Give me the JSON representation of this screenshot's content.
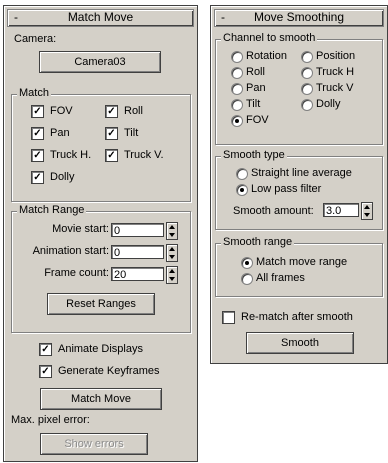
{
  "match_move": {
    "title": "Match Move",
    "collapse_symbol": "-",
    "camera_label": "Camera:",
    "camera_button": "Camera03",
    "match_group": {
      "title": "Match",
      "checkboxes": [
        {
          "label": "FOV",
          "checked": true
        },
        {
          "label": "Roll",
          "checked": true
        },
        {
          "label": "Pan",
          "checked": true
        },
        {
          "label": "Tilt",
          "checked": true
        },
        {
          "label": "Truck H.",
          "checked": true
        },
        {
          "label": "Truck V.",
          "checked": true
        },
        {
          "label": "Dolly",
          "checked": true
        }
      ]
    },
    "range_group": {
      "title": "Match Range",
      "movie_start_label": "Movie start:",
      "movie_start_value": "0",
      "animation_start_label": "Animation start:",
      "animation_start_value": "0",
      "frame_count_label": "Frame count:",
      "frame_count_value": "20",
      "reset_button": "Reset Ranges"
    },
    "animate_displays": {
      "label": "Animate Displays",
      "checked": true
    },
    "generate_keyframes": {
      "label": "Generate Keyframes",
      "checked": true
    },
    "match_move_button": "Match Move",
    "max_pixel_error_label": "Max. pixel error:",
    "show_errors_button": "Show errors",
    "check_glyph": "✓"
  },
  "move_smoothing": {
    "title": "Move Smoothing",
    "collapse_symbol": "-",
    "channel_group": {
      "title": "Channel to smooth",
      "options": [
        {
          "label": "Rotation",
          "selected": false
        },
        {
          "label": "Position",
          "selected": false
        },
        {
          "label": "Roll",
          "selected": false
        },
        {
          "label": "Truck H",
          "selected": false
        },
        {
          "label": "Pan",
          "selected": false
        },
        {
          "label": "Truck V",
          "selected": false
        },
        {
          "label": "Tilt",
          "selected": false
        },
        {
          "label": "Dolly",
          "selected": false
        },
        {
          "label": "FOV",
          "selected": true
        }
      ]
    },
    "smooth_type_group": {
      "title": "Smooth type",
      "options": [
        {
          "label": "Straight line average",
          "selected": false
        },
        {
          "label": "Low pass filter",
          "selected": true
        }
      ],
      "smooth_amount_label": "Smooth amount:",
      "smooth_amount_value": "3.0"
    },
    "smooth_range_group": {
      "title": "Smooth range",
      "options": [
        {
          "label": "Match move range",
          "selected": true
        },
        {
          "label": "All frames",
          "selected": false
        }
      ]
    },
    "rematch": {
      "label": "Re-match after smooth",
      "checked": false
    },
    "smooth_button": "Smooth"
  },
  "colors": {
    "panel": "#d4d0c8",
    "disabled_text": "#8c8c8c"
  }
}
